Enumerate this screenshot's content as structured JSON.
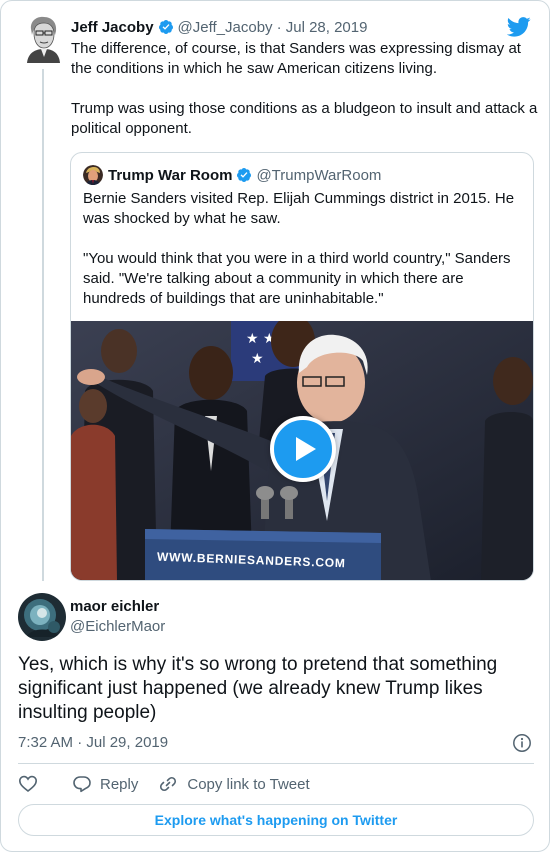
{
  "colors": {
    "brand": "#1d9bf0",
    "text": "#0f1419",
    "muted": "#536471",
    "border": "#cfd9de"
  },
  "parent_tweet": {
    "name": "Jeff Jacoby",
    "handle": "@Jeff_Jacoby",
    "date": "· Jul 28, 2019",
    "text_p1": "The difference, of course, is that Sanders was expressing dismay at the conditions in which he saw American citizens living.",
    "text_p2": "Trump was using those conditions as a bludgeon to insult and attack a political opponent.",
    "verified_icon": "verified-badge-icon",
    "brand_icon": "twitter-bird-icon"
  },
  "quote_tweet": {
    "name": "Trump War Room",
    "handle": "@TrumpWarRoom",
    "text_p1": "Bernie Sanders visited Rep. Elijah Cummings district in 2015. He was shocked by what he saw.",
    "text_p2": "\"You would think that you were in a third world country,\" Sanders said. \"We're talking about a community in which there are hundreds of buildings that are uninhabitable.\"",
    "media": {
      "podium_text": "WWW.BERNIESANDERS.COM",
      "play_icon": "play-icon"
    }
  },
  "main_tweet": {
    "name": "maor eichler",
    "handle": "@EichlerMaor",
    "text": "Yes, which is why it's so wrong to pretend that something significant just happened (we already knew Trump likes insulting people)",
    "timestamp": "7:32 AM · Jul 29, 2019",
    "info_icon": "info-icon"
  },
  "actions": {
    "like_icon": "heart-icon",
    "reply_label": "Reply",
    "reply_icon": "reply-icon",
    "copy_link_label": "Copy link to Tweet",
    "copy_link_icon": "link-icon"
  },
  "footer": {
    "explore_label": "Explore what's happening on Twitter"
  }
}
